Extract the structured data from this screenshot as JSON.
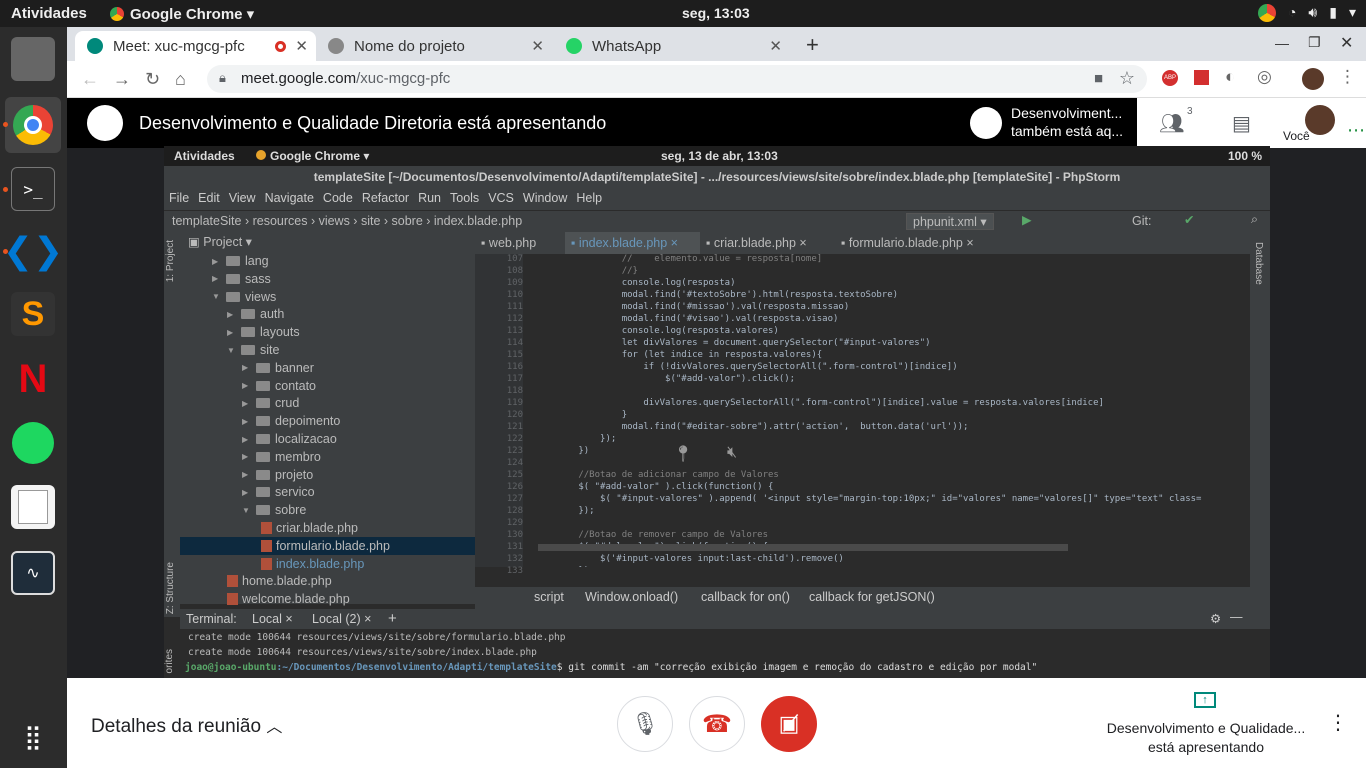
{
  "topbar": {
    "activities": "Atividades",
    "app": "Google Chrome",
    "clock": "seg, 13:03"
  },
  "tabs": [
    {
      "title": "Meet: xuc-mgcg-pfc"
    },
    {
      "title": "Nome do projeto"
    },
    {
      "title": "WhatsApp"
    }
  ],
  "address": {
    "host": "meet.google.com",
    "path": "/xuc-mgcg-pfc"
  },
  "meet": {
    "presenting": "Desenvolvimento e Qualidade Diretoria está apresentando",
    "presenter_tile_l1": "Desenvolviment...",
    "presenter_tile_l2": "também está aq...",
    "participants_count": "3",
    "you": "Você",
    "details": "Detalhes da reunião",
    "pres_info_l1": "Desenvolvimento e Qualidade...",
    "pres_info_l2": "está apresentando"
  },
  "shared": {
    "activities": "Atividades",
    "app": "Google Chrome",
    "clock": "seg, 13 de abr, 13:03",
    "battery": "100 %",
    "title": "templateSite [~/Documentos/Desenvolvimento/Adapti/templateSite] - .../resources/views/site/sobre/index.blade.php [templateSite] - PhpStorm",
    "menu": [
      "File",
      "Edit",
      "View",
      "Navigate",
      "Code",
      "Refactor",
      "Run",
      "Tools",
      "VCS",
      "Window",
      "Help"
    ],
    "crumbs": "templateSite  ›  resources  ›  views  ›  site  ›  sobre  ›  index.blade.php",
    "run_config": "phpunit.xml",
    "git": "Git:",
    "project_label": "Project",
    "tree": [
      {
        "label": "lang",
        "type": "folder",
        "depth": 0
      },
      {
        "label": "sass",
        "type": "folder",
        "depth": 0
      },
      {
        "label": "views",
        "type": "folder",
        "depth": 0
      },
      {
        "label": "auth",
        "type": "folder",
        "depth": 1
      },
      {
        "label": "layouts",
        "type": "folder",
        "depth": 1
      },
      {
        "label": "site",
        "type": "folder",
        "depth": 1
      },
      {
        "label": "banner",
        "type": "folder",
        "depth": 2
      },
      {
        "label": "contato",
        "type": "folder",
        "depth": 2
      },
      {
        "label": "crud",
        "type": "folder",
        "depth": 2
      },
      {
        "label": "depoimento",
        "type": "folder",
        "depth": 2
      },
      {
        "label": "localizacao",
        "type": "folder",
        "depth": 2
      },
      {
        "label": "membro",
        "type": "folder",
        "depth": 2
      },
      {
        "label": "projeto",
        "type": "folder",
        "depth": 2
      },
      {
        "label": "servico",
        "type": "folder",
        "depth": 2
      },
      {
        "label": "sobre",
        "type": "folder",
        "depth": 2
      },
      {
        "label": "criar.blade.php",
        "type": "file",
        "depth": 3
      },
      {
        "label": "formulario.blade.php",
        "type": "file",
        "depth": 3,
        "selected": true
      },
      {
        "label": "index.blade.php",
        "type": "file",
        "depth": 3
      },
      {
        "label": "home.blade.php",
        "type": "file",
        "depth": 1
      },
      {
        "label": "welcome.blade.php",
        "type": "file",
        "depth": 1
      }
    ],
    "editor_tabs": [
      "web.php",
      "index.blade.php",
      "criar.blade.php",
      "formulario.blade.php"
    ],
    "lines": [
      {
        "n": "107",
        "t": "                //    elemento.value = resposta[nome]"
      },
      {
        "n": "108",
        "t": "                //}"
      },
      {
        "n": "109",
        "t": "                console.log(resposta)"
      },
      {
        "n": "110",
        "t": "                modal.find('#textoSobre').html(resposta.textoSobre)"
      },
      {
        "n": "111",
        "t": "                modal.find('#missao').val(resposta.missao)"
      },
      {
        "n": "112",
        "t": "                modal.find('#visao').val(resposta.visao)"
      },
      {
        "n": "113",
        "t": "                console.log(resposta.valores)"
      },
      {
        "n": "114",
        "t": "                let divValores = document.querySelector(\"#input-valores\")"
      },
      {
        "n": "115",
        "t": "                for (let indice in resposta.valores){"
      },
      {
        "n": "116",
        "t": "                    if (!divValores.querySelectorAll(\".form-control\")[indice])"
      },
      {
        "n": "117",
        "t": "                        $(\"#add-valor\").click();"
      },
      {
        "n": "118",
        "t": ""
      },
      {
        "n": "119",
        "t": "                    divValores.querySelectorAll(\".form-control\")[indice].value = resposta.valores[indice]"
      },
      {
        "n": "120",
        "t": "                }"
      },
      {
        "n": "121",
        "t": "                modal.find(\"#editar-sobre\").attr('action',  button.data('url'));"
      },
      {
        "n": "122",
        "t": "            });"
      },
      {
        "n": "123",
        "t": "        })"
      },
      {
        "n": "124",
        "t": ""
      },
      {
        "n": "125",
        "t": "        //Botao de adicionar campo de Valores"
      },
      {
        "n": "126",
        "t": "        $( \"#add-valor\" ).click(function() {"
      },
      {
        "n": "127",
        "t": "            $( \"#input-valores\" ).append( '<input style=\"margin-top:10px;\" id=\"valores\" name=\"valores[]\" type=\"text\" class="
      },
      {
        "n": "128",
        "t": "        });"
      },
      {
        "n": "129",
        "t": ""
      },
      {
        "n": "130",
        "t": "        //Botao de remover campo de Valores"
      },
      {
        "n": "131",
        "t": "        $( \"#del-valor\").click(function() {"
      },
      {
        "n": "132",
        "t": "            $('#input-valores input:last-child').remove()"
      },
      {
        "n": "133",
        "t": "        });"
      }
    ],
    "status": [
      "script",
      "Window.onload()",
      "callback for on()",
      "callback for getJSON()"
    ],
    "terminal_label": "Terminal:",
    "terminal_tabs": [
      "Local",
      "Local (2)"
    ],
    "terminal_lines": [
      "create mode 100644 resources/views/site/sobre/formulario.blade.php",
      "create mode 100644 resources/views/site/sobre/index.blade.php"
    ],
    "prompt_user": "joao@joao-ubuntu",
    "prompt_path": ":~/Documentos/Desenvolvimento/Adapti/templateSite",
    "prompt_cmd": "$ git commit -am \"correção exibição imagem e remoção do cadastro e edição por modal\"",
    "left_tool_top": "1: Project",
    "left_tool_bottom": "Z: Structure",
    "left_tool_fav": "orites",
    "right_tool": "Database"
  },
  "colors": {
    "meet_red": "#d93025",
    "pst_blue": "#6897bb"
  }
}
